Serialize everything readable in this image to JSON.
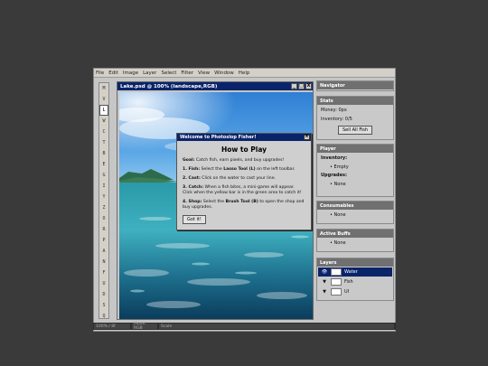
{
  "menubar": {
    "items": [
      "File",
      "Edit",
      "Image",
      "Layer",
      "Select",
      "Filter",
      "View",
      "Window",
      "Help"
    ]
  },
  "toolbar": {
    "tools": [
      "M",
      "V",
      "L",
      "W",
      "C",
      "T",
      "B",
      "E",
      "G",
      "I",
      "Y",
      "Z",
      "O",
      "R",
      "P",
      "A",
      "N",
      "F",
      "U",
      "D",
      "S",
      "Q",
      "H",
      "Z"
    ],
    "active_index": 2
  },
  "document": {
    "title": "Lake.psd @ 100% (landscape,RGB)",
    "buttons": [
      "_",
      "□",
      "X"
    ]
  },
  "dialog": {
    "title": "Welcome to Photoslop Fisher!",
    "close": "X",
    "heading": "How to Play",
    "goal_label": "Goal:",
    "goal_text": "Catch fish, earn pixels, and buy upgrades!",
    "step1_label": "1. Fish:",
    "step1_pre": "Select the",
    "step1_tool": "Lasso Tool (L)",
    "step1_post": "on the left toolbar.",
    "step2_label": "2. Cast:",
    "step2_text": "Click on the water to cast your line.",
    "step3_label": "3. Catch:",
    "step3_text": "When a fish bites, a mini-game will appear. Click when the yellow bar is in the green area to catch it!",
    "step4_label": "4. Shop:",
    "step4_pre": "Select the",
    "step4_tool": "Brush Tool (B)",
    "step4_post": "to open the shop and buy upgrades.",
    "ok_label": "Got it!"
  },
  "panels": {
    "navigator": {
      "title": "Navigator"
    },
    "stats": {
      "title": "Stats",
      "money_label": "Money:",
      "money_value": "0px",
      "inventory_label": "Inventory:",
      "inventory_value": "0/5",
      "sell_label": "Sell All Fish"
    },
    "player": {
      "title": "Player",
      "inventory_heading": "Inventory:",
      "inventory_item": "Empty",
      "upgrades_heading": "Upgrades:",
      "upgrades_item": "None"
    },
    "consumables": {
      "title": "Consumables",
      "item": "None"
    },
    "buffs": {
      "title": "Active Buffs",
      "item": "None"
    },
    "layers": {
      "title": "Layers",
      "items": [
        {
          "name": "Water",
          "selected": true,
          "eye": "👁"
        },
        {
          "name": "Fish",
          "selected": false,
          "eye": "▼"
        },
        {
          "name": "UI",
          "selected": false,
          "eye": "▼"
        }
      ]
    }
  },
  "statusbar": {
    "cells": [
      "100% / 8f",
      "Mode: RGB",
      "Scale"
    ]
  },
  "colors": {
    "titlebar": "#0a246a",
    "panel_title": "#707070",
    "water_light": "#7ad0e0",
    "water_dark": "#0a3a5a",
    "sky": "#3a8ad8"
  }
}
